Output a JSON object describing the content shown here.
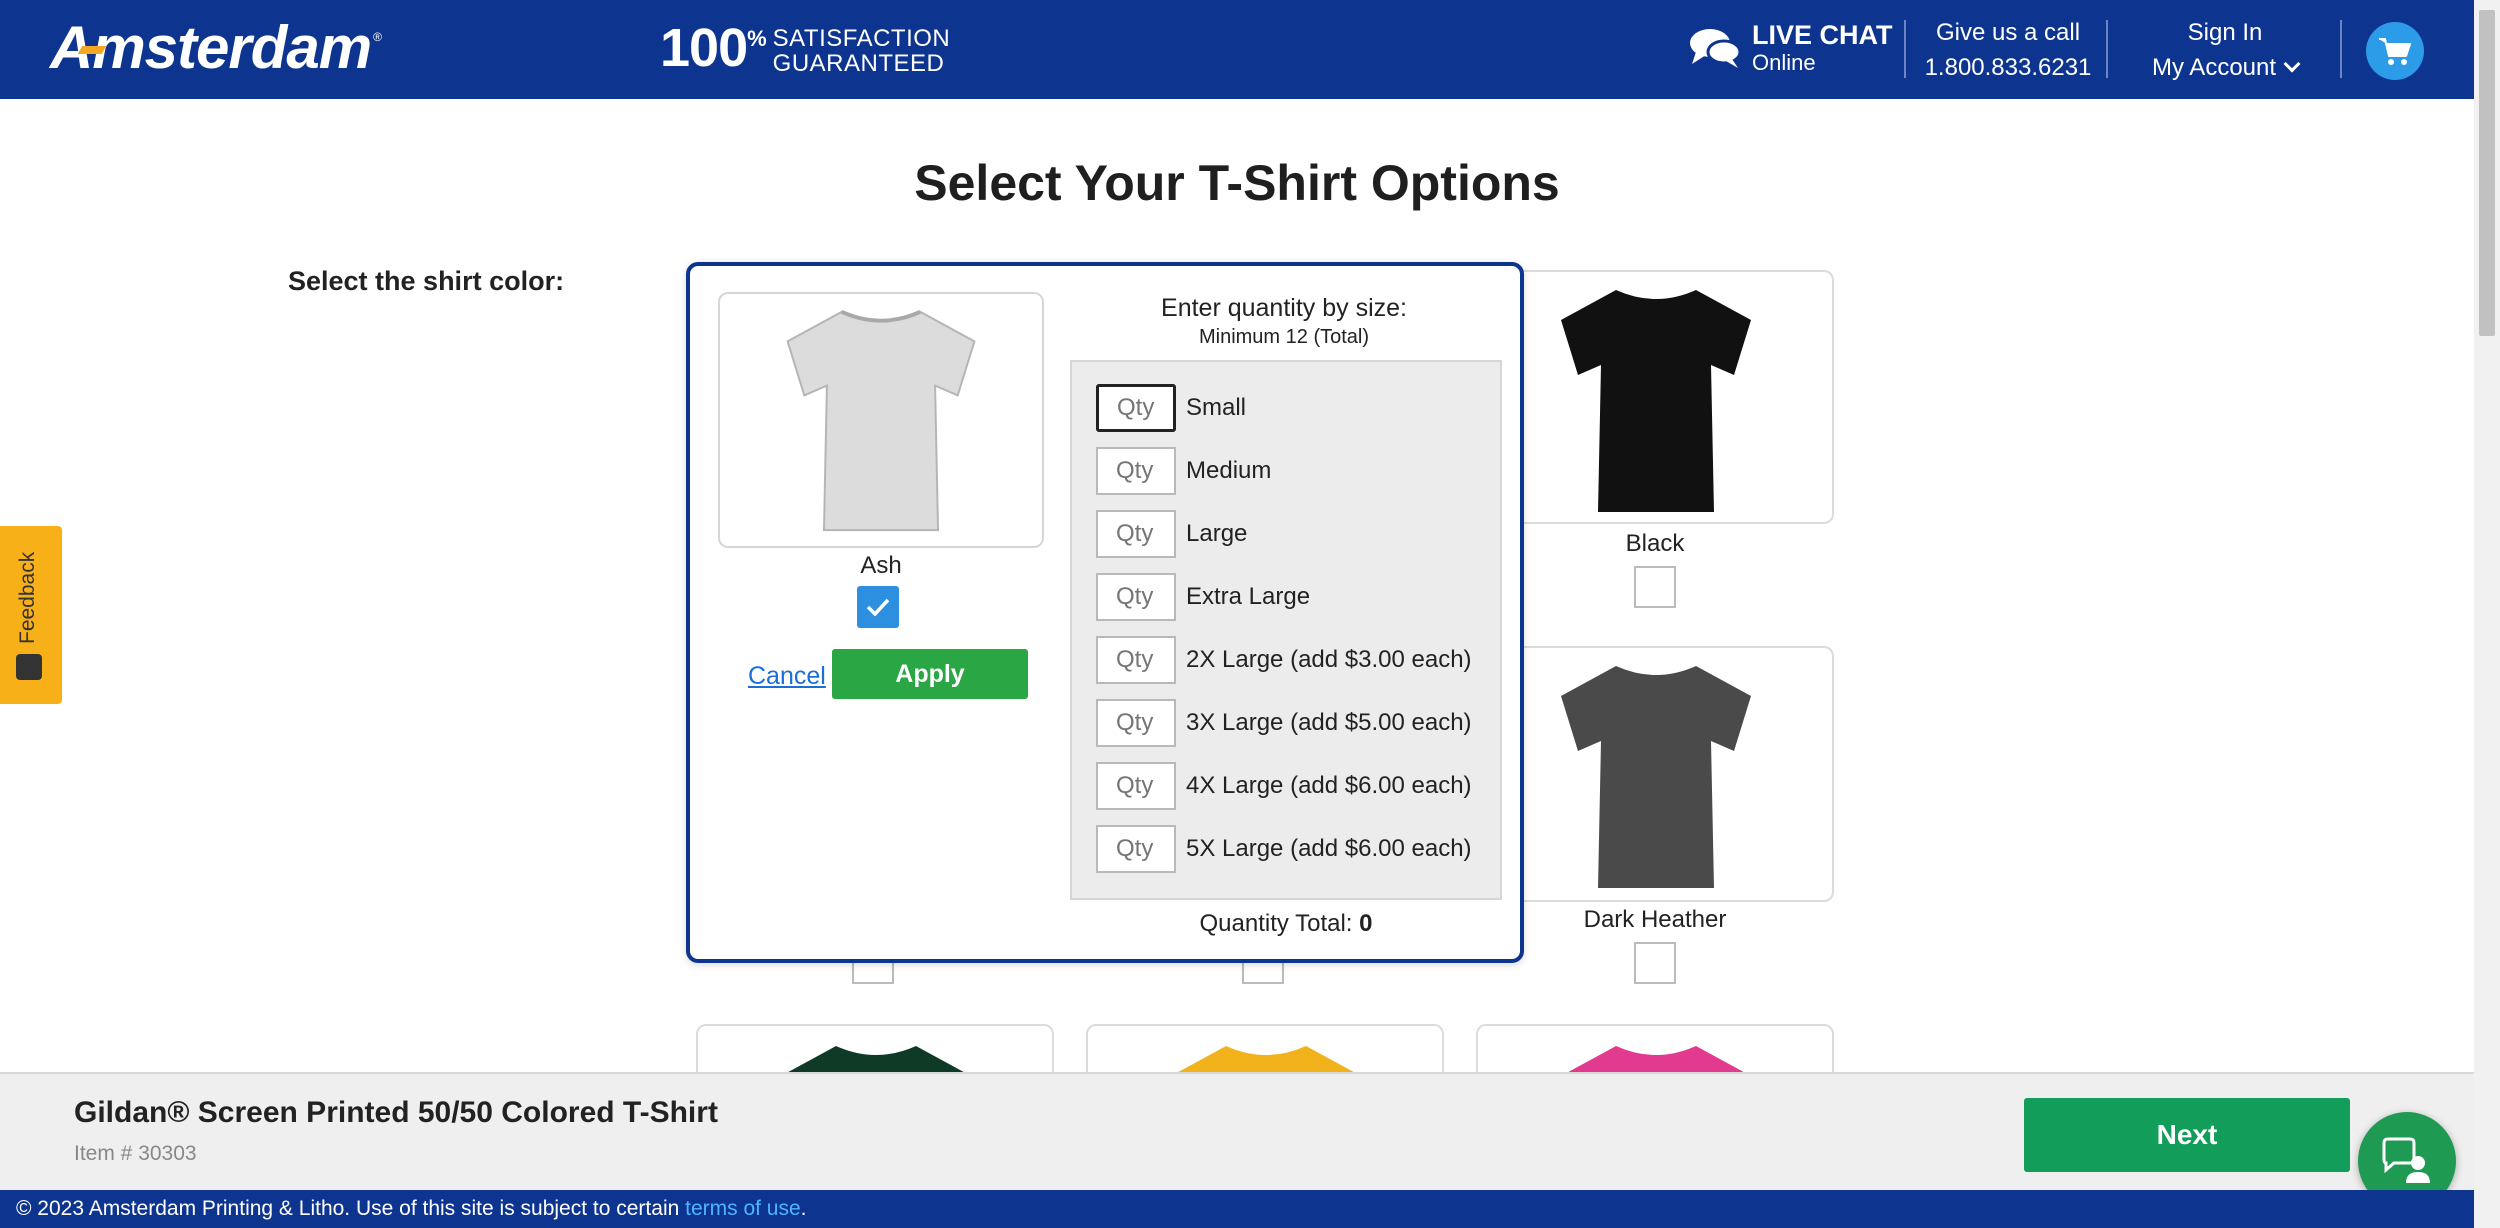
{
  "header": {
    "logo_text": "Amsterdam",
    "logo_reg": "®",
    "satisfaction_number": "100",
    "satisfaction_percent": "%",
    "satisfaction_line1": "SATISFACTION",
    "satisfaction_line2": "GUARANTEED",
    "live_chat_title": "LIVE CHAT",
    "live_chat_status": "Online",
    "call_label": "Give us a call",
    "call_number": "1.800.833.6231",
    "sign_in": "Sign In",
    "my_account": "My Account"
  },
  "page": {
    "title": "Select Your T-Shirt Options",
    "color_label": "Select the shirt color:"
  },
  "colors": [
    {
      "name": "Black",
      "hex": "#111111"
    },
    {
      "name": "Dark Heather",
      "hex": "#4a4a4a"
    }
  ],
  "partial_colors": [
    {
      "hex": "#0f3a26"
    },
    {
      "hex": "#f2b21b"
    },
    {
      "hex": "#e23a8e"
    }
  ],
  "modal": {
    "color_name": "Ash",
    "color_hex": "#dcdcdc",
    "cancel_label": "Cancel",
    "apply_label": "Apply",
    "heading": "Enter quantity by size:",
    "subheading": "Minimum 12 (Total)",
    "qty_placeholder": "Qty",
    "sizes": [
      {
        "label": "Small"
      },
      {
        "label": "Medium"
      },
      {
        "label": "Large"
      },
      {
        "label": "Extra Large"
      },
      {
        "label": "2X Large (add $3.00 each)"
      },
      {
        "label": "3X Large (add $5.00 each)"
      },
      {
        "label": "4X Large (add $6.00 each)"
      },
      {
        "label": "5X Large (add $6.00 each)"
      }
    ],
    "total_label": "Quantity Total:",
    "total_value": "0"
  },
  "feedback_label": "Feedback",
  "bottom": {
    "product_name": "Gildan® Screen Printed 50/50 Colored T-Shirt",
    "item_number": "Item # 30303",
    "next_label": "Next"
  },
  "footer": {
    "text": "© 2023 Amsterdam Printing & Litho. Use of this site is subject to certain ",
    "link": "terms of use",
    "end": "."
  },
  "theme": {
    "brand_blue": "#0d3590",
    "apply_green": "#2aa744",
    "next_green": "#129d5a",
    "check_blue": "#2d8fe0",
    "feedback_yellow": "#f8b018"
  }
}
